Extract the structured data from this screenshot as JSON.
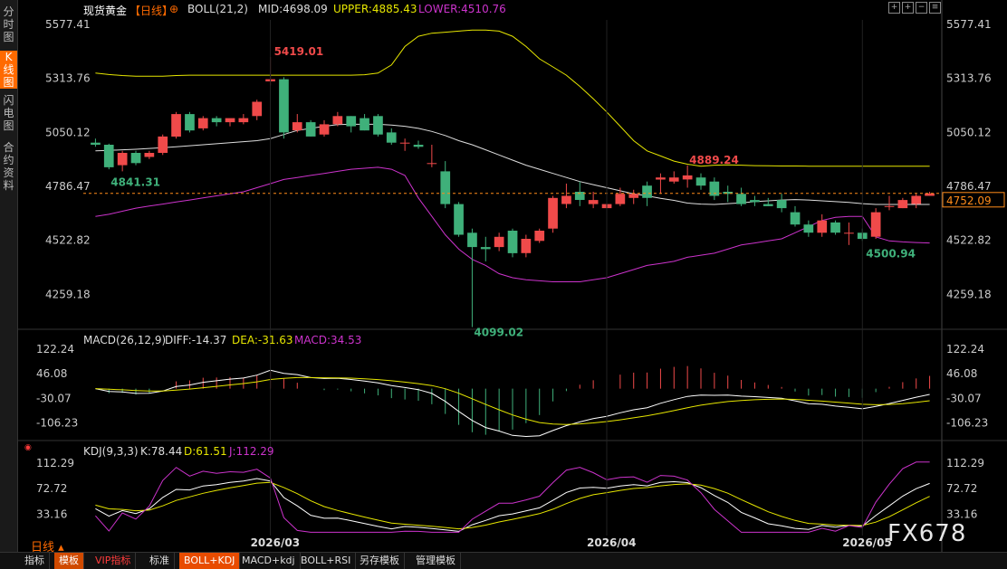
{
  "sidebar": {
    "tabs": [
      "分时图",
      "K线图",
      "闪电图",
      "合约资料"
    ],
    "active": 1
  },
  "header": {
    "symbol": "现货黄金",
    "period": "【日线】",
    "add_icon": "⊕",
    "boll": "BOLL(21,2)",
    "mid": "MID:4698.09",
    "upper": "UPPER:4885.43",
    "lower": "LOWER:4510.76"
  },
  "colors": {
    "up": "#f04a4a",
    "down": "#3fb07a",
    "mid": "#dddddd",
    "upper": "#e6e600",
    "lower": "#cc33cc",
    "macd_diff": "#ffffff",
    "macd_dea": "#e6e600",
    "kdj_k": "#ffffff",
    "kdj_d": "#e6e600",
    "kdj_j": "#cc33cc",
    "accent": "#ff6a00"
  },
  "price_axis": {
    "labels": [
      "5577.41",
      "5313.76",
      "5050.12",
      "4786.47",
      "4522.82",
      "4259.18"
    ]
  },
  "current_price": "4752.09",
  "annotations": {
    "high": "5419.01",
    "low": "4099.02",
    "a1": "4841.31",
    "a2": "4889.24",
    "a3": "4500.94"
  },
  "macd": {
    "title": "MACD(26,12,9)",
    "diff": "DIFF:-14.37",
    "dea": "DEA:-31.63",
    "macd": "MACD:34.53",
    "labels": [
      "122.24",
      "46.08",
      "-30.07",
      "-106.23"
    ]
  },
  "kdj": {
    "title": "KDJ(9,3,3)",
    "k": "K:78.44",
    "d": "D:61.51",
    "j": "J:112.29",
    "labels": [
      "112.29",
      "72.72",
      "33.16"
    ]
  },
  "dates": [
    "2026/03",
    "2026/04",
    "2026/05"
  ],
  "period_label": "日线",
  "bottom_tabs": [
    "指标",
    "模板",
    "VIP指标",
    "标准",
    "BOLL+KDJ",
    "MACD+kdj",
    "BOLL+RSI",
    "另存模板",
    "管理模板"
  ],
  "watermark": "FX678",
  "chart_data": {
    "type": "candlestick",
    "ylim": [
      4150,
      5600
    ],
    "candles": [
      [
        5000,
        5020,
        4990,
        4980
      ],
      [
        4990,
        4995,
        4880,
        4870
      ],
      [
        4890,
        4960,
        4950,
        4860
      ],
      [
        4950,
        4960,
        4900,
        4890
      ],
      [
        4930,
        4960,
        4950,
        4920
      ],
      [
        4950,
        5040,
        5030,
        4940
      ],
      [
        5030,
        5150,
        5140,
        5020
      ],
      [
        5140,
        5150,
        5060,
        5050
      ],
      [
        5070,
        5130,
        5120,
        5060
      ],
      [
        5120,
        5130,
        5100,
        5080
      ],
      [
        5100,
        5110,
        5120,
        5080
      ],
      [
        5100,
        5140,
        5120,
        5090
      ],
      [
        5130,
        5210,
        5200,
        5110
      ],
      [
        5300,
        5419,
        5310,
        5280
      ],
      [
        5310,
        5320,
        5050,
        5020
      ],
      [
        5060,
        5140,
        5100,
        5050
      ],
      [
        5100,
        5110,
        5030,
        5030
      ],
      [
        5040,
        5110,
        5090,
        5030
      ],
      [
        5090,
        5150,
        5130,
        5080
      ],
      [
        5130,
        5130,
        5080,
        5050
      ],
      [
        5120,
        5140,
        5060,
        5060
      ],
      [
        5130,
        5140,
        5040,
        5030
      ],
      [
        5050,
        5070,
        5000,
        4990
      ],
      [
        5000,
        5020,
        5000,
        4960
      ],
      [
        4990,
        5010,
        4980,
        4970
      ],
      [
        4900,
        4990,
        4900,
        4880
      ],
      [
        4860,
        4910,
        4700,
        4680
      ],
      [
        4700,
        4710,
        4550,
        4540
      ],
      [
        4560,
        4580,
        4490,
        4099
      ],
      [
        4490,
        4540,
        4480,
        4420
      ],
      [
        4490,
        4560,
        4540,
        4470
      ],
      [
        4570,
        4580,
        4460,
        4440
      ],
      [
        4460,
        4550,
        4530,
        4440
      ],
      [
        4520,
        4580,
        4570,
        4510
      ],
      [
        4580,
        4740,
        4730,
        4560
      ],
      [
        4700,
        4800,
        4740,
        4680
      ],
      [
        4760,
        4810,
        4720,
        4690
      ],
      [
        4700,
        4760,
        4720,
        4680
      ],
      [
        4680,
        4730,
        4700,
        4650
      ],
      [
        4700,
        4780,
        4750,
        4690
      ],
      [
        4730,
        4770,
        4750,
        4700
      ],
      [
        4790,
        4810,
        4730,
        4690
      ],
      [
        4820,
        4850,
        4830,
        4750
      ],
      [
        4810,
        4860,
        4830,
        4800
      ],
      [
        4820,
        4889,
        4840,
        4780
      ],
      [
        4830,
        4850,
        4790,
        4770
      ],
      [
        4810,
        4830,
        4740,
        4720
      ],
      [
        4760,
        4790,
        4750,
        4710
      ],
      [
        4750,
        4780,
        4700,
        4690
      ],
      [
        4720,
        4740,
        4710,
        4690
      ],
      [
        4700,
        4730,
        4690,
        4690
      ],
      [
        4720,
        4750,
        4680,
        4660
      ],
      [
        4660,
        4690,
        4600,
        4590
      ],
      [
        4600,
        4620,
        4560,
        4540
      ],
      [
        4560,
        4650,
        4620,
        4540
      ],
      [
        4610,
        4620,
        4560,
        4550
      ],
      [
        4560,
        4610,
        4560,
        4500
      ],
      [
        4560,
        4580,
        4530,
        4520
      ],
      [
        4540,
        4680,
        4660,
        4530
      ],
      [
        4690,
        4740,
        4690,
        4670
      ],
      [
        4680,
        4730,
        4720,
        4680
      ],
      [
        4700,
        4750,
        4740,
        4680
      ],
      [
        4740,
        4760,
        4752,
        4740
      ]
    ],
    "mid": [
      4960,
      4962,
      4965,
      4968,
      4972,
      4976,
      4980,
      4985,
      4990,
      4995,
      5000,
      5005,
      5010,
      5020,
      5040,
      5060,
      5070,
      5080,
      5088,
      5090,
      5090,
      5090,
      5086,
      5080,
      5070,
      5055,
      5035,
      5010,
      4990,
      4965,
      4940,
      4915,
      4890,
      4870,
      4850,
      4830,
      4810,
      4795,
      4780,
      4765,
      4750,
      4740,
      4728,
      4718,
      4705,
      4700,
      4698,
      4702,
      4706,
      4712,
      4716,
      4720,
      4722,
      4720,
      4716,
      4712,
      4708,
      4702,
      4698,
      4698,
      4698,
      4698,
      4698
    ],
    "upper": [
      5340,
      5333,
      5328,
      5325,
      5325,
      5325,
      5328,
      5330,
      5330,
      5330,
      5330,
      5330,
      5330,
      5330,
      5330,
      5330,
      5330,
      5330,
      5330,
      5330,
      5332,
      5340,
      5380,
      5470,
      5520,
      5535,
      5540,
      5545,
      5550,
      5550,
      5545,
      5520,
      5470,
      5410,
      5370,
      5330,
      5275,
      5215,
      5150,
      5080,
      5010,
      4960,
      4935,
      4910,
      4895,
      4885,
      4890,
      4892,
      4890,
      4888,
      4887,
      4886,
      4886,
      4885,
      4885,
      4885,
      4885,
      4885,
      4885,
      4885,
      4885,
      4885,
      4885
    ],
    "lower": [
      4640,
      4650,
      4665,
      4680,
      4690,
      4700,
      4710,
      4720,
      4730,
      4740,
      4750,
      4760,
      4780,
      4800,
      4820,
      4830,
      4840,
      4850,
      4860,
      4870,
      4875,
      4880,
      4870,
      4840,
      4730,
      4640,
      4550,
      4480,
      4430,
      4400,
      4360,
      4340,
      4330,
      4325,
      4320,
      4320,
      4320,
      4330,
      4340,
      4360,
      4380,
      4400,
      4410,
      4420,
      4440,
      4450,
      4460,
      4480,
      4500,
      4510,
      4520,
      4530,
      4560,
      4590,
      4620,
      4635,
      4640,
      4640,
      4540,
      4520,
      4515,
      4512,
      4510
    ],
    "macd": {
      "ylim": [
        -155,
        125
      ]
    },
    "kdj": {
      "ylim": [
        0,
        118
      ]
    }
  }
}
